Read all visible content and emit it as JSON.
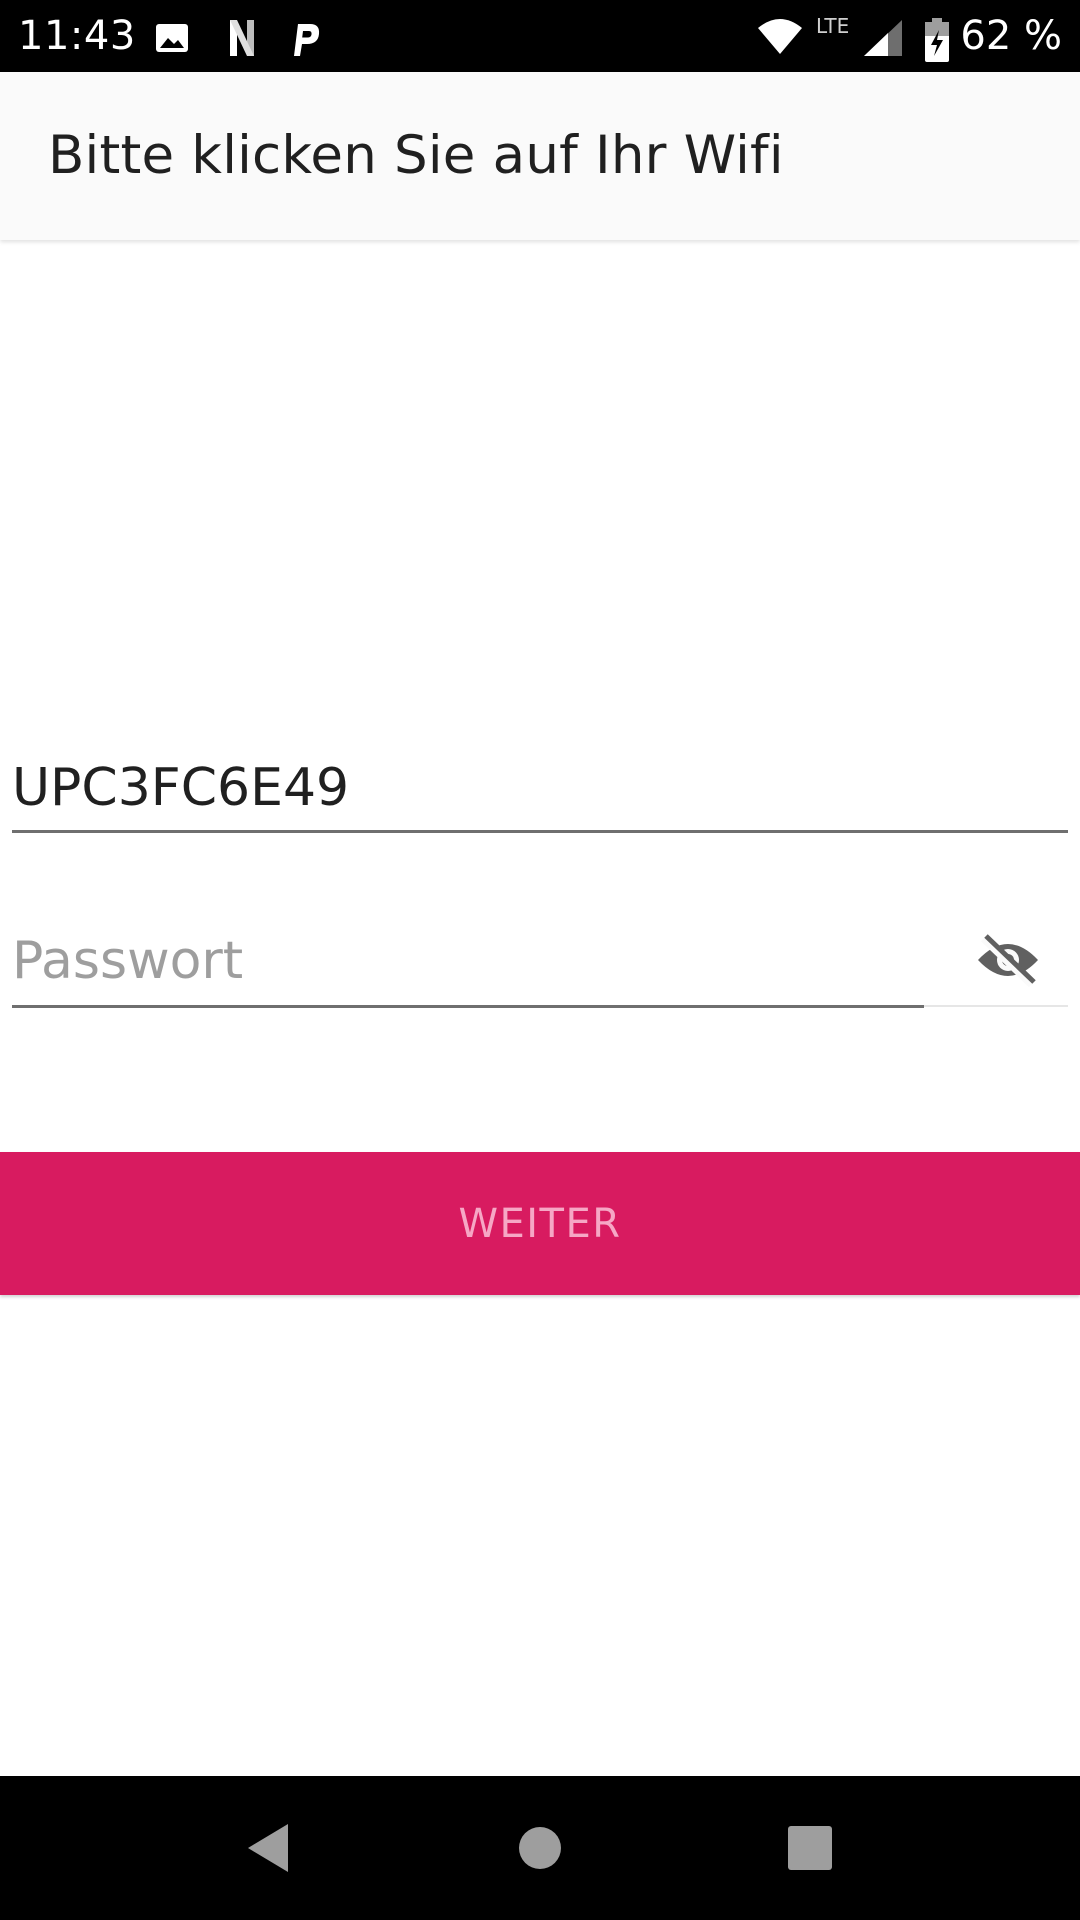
{
  "status_bar": {
    "time": "11:43",
    "battery": "62 %",
    "network_label": "LTE",
    "icons": [
      "image-icon",
      "netflix-icon",
      "parking-icon",
      "wifi-icon",
      "lte-signal-icon",
      "battery-charging-icon"
    ]
  },
  "app_bar": {
    "title": "Bitte klicken Sie auf Ihr Wifi"
  },
  "form": {
    "ssid_value": "UPC3FC6E49",
    "password_value": "",
    "password_placeholder": "Passwort",
    "visibility_icon": "visibility-off-icon"
  },
  "button": {
    "label": "WEITER"
  },
  "nav_bar": {
    "icons": [
      "back-icon",
      "home-icon",
      "recents-icon"
    ]
  },
  "colors": {
    "accent": "#d81b60",
    "button_text": "#f6a7c5",
    "app_bar_bg": "#fafafa",
    "text_primary": "#202020",
    "placeholder": "#9e9e9e"
  }
}
